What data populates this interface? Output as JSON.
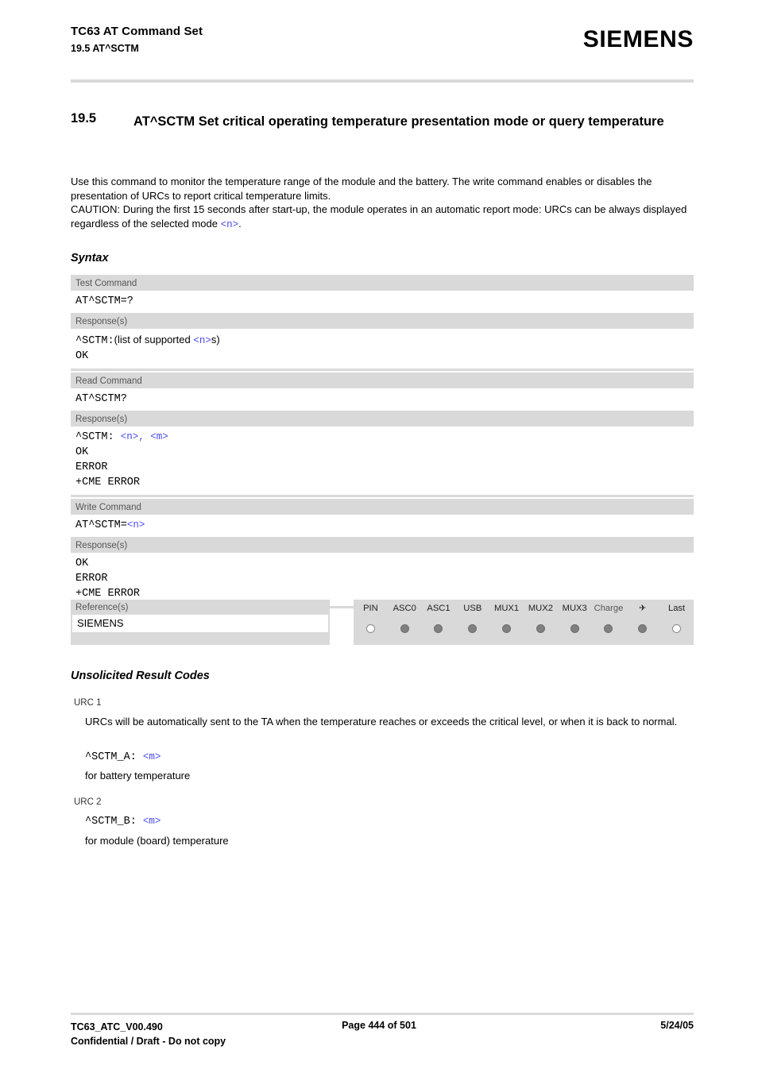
{
  "header": {
    "title": "TC63 AT Command Set",
    "subtitle": "19.5 AT^SCTM",
    "brand": "SIEMENS"
  },
  "section": {
    "number": "19.5",
    "title": "AT^SCTM   Set critical operating temperature presentation mode or query temperature"
  },
  "intro": {
    "paragraph1": "Use this command to monitor the temperature range of the module and the battery. The write command enables or disables the presentation of URCs to report critical temperature limits.",
    "paragraph2_a": "CAUTION: During the first 15 seconds after start-up, the module operates in an automatic report mode: URCs can be always displayed regardless of the selected mode ",
    "paragraph2_param": "<n>",
    "paragraph2_b": "."
  },
  "labels": {
    "syntax": "Syntax",
    "urc_heading": "Unsolicited Result Codes",
    "test_command": "Test Command",
    "read_command": "Read Command",
    "write_command": "Write Command",
    "responses": "Response(s)",
    "references": "Reference(s)"
  },
  "test_command": {
    "command": "AT^SCTM=?",
    "response_line1_a": "^SCTM:",
    "response_line1_b": "(list of supported ",
    "response_line1_param": "<n>",
    "response_line1_c": "s)",
    "response_line2": "OK"
  },
  "read_command": {
    "command": "AT^SCTM?",
    "response_line1_a": "^SCTM: ",
    "response_line1_params": "<n>, <m>",
    "response_line2": "OK",
    "response_line3": "ERROR",
    "response_line4": "+CME ERROR"
  },
  "write_command": {
    "command_a": "AT^SCTM=",
    "command_param": "<n>",
    "response_line1": "OK",
    "response_line2": "ERROR",
    "response_line3": "+CME ERROR"
  },
  "reference": {
    "value": "SIEMENS"
  },
  "pin_table": {
    "columns": [
      {
        "label": "PIN",
        "state": "empty"
      },
      {
        "label": "ASC0",
        "state": "filled"
      },
      {
        "label": "ASC1",
        "state": "filled"
      },
      {
        "label": "USB",
        "state": "filled"
      },
      {
        "label": "MUX1",
        "state": "filled"
      },
      {
        "label": "MUX2",
        "state": "filled"
      },
      {
        "label": "MUX3",
        "state": "filled"
      },
      {
        "label": "Charge",
        "state": "filled"
      },
      {
        "label": "✈",
        "state": "filled"
      },
      {
        "label": "Last",
        "state": "empty"
      }
    ]
  },
  "urc": {
    "urc1_label": "URC 1",
    "urc1_text": "URCs will be automatically sent to the TA when the temperature reaches or exceeds the critical level, or when it is back to normal.",
    "urc1_code_a": "^SCTM_A: ",
    "urc1_code_param": "<m>",
    "urc1_note": "for battery temperature",
    "urc2_label": "URC 2",
    "urc2_code_a": "^SCTM_B: ",
    "urc2_code_param": "<m>",
    "urc2_note": "for module (board) temperature"
  },
  "footer": {
    "doc_id": "TC63_ATC_V00.490",
    "confidential": "Confidential / Draft - Do not copy",
    "page": "Page 444 of 501",
    "date": "5/24/05"
  },
  "colors": {
    "param_blue": "#4a4af0",
    "band_gray": "#d9d9d9",
    "dot_gray": "#808080"
  }
}
